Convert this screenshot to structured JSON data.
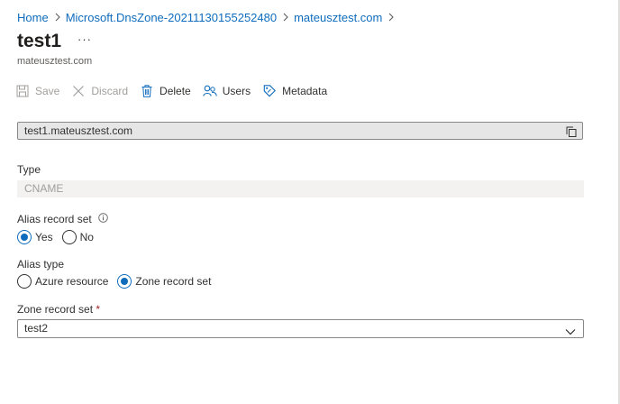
{
  "breadcrumb": {
    "items": [
      "Home",
      "Microsoft.DnsZone-20211130155252480",
      "mateusztest.com"
    ]
  },
  "header": {
    "title": "test1",
    "more_label": "···",
    "subtitle": "mateusztest.com"
  },
  "toolbar": {
    "save_label": "Save",
    "discard_label": "Discard",
    "delete_label": "Delete",
    "users_label": "Users",
    "metadata_label": "Metadata"
  },
  "form": {
    "name_value": "test1.mateusztest.com",
    "type_label": "Type",
    "type_value": "CNAME",
    "alias_record_set_label": "Alias record set",
    "alias_yes": "Yes",
    "alias_no": "No",
    "alias_selected": "Yes",
    "alias_type_label": "Alias type",
    "alias_type_azure": "Azure resource",
    "alias_type_zone": "Zone record set",
    "alias_type_selected": "Zone record set",
    "zone_record_set_label": "Zone record set",
    "required_mark": "*",
    "zone_record_set_value": "test2"
  },
  "colors": {
    "accent": "#0f6cbd",
    "required": "#a4262c",
    "disabled_text": "#a19f9d"
  },
  "icons": [
    "chevron-right-icon",
    "more-icon",
    "save-icon",
    "discard-icon",
    "delete-icon",
    "users-icon",
    "metadata-icon",
    "copy-icon",
    "info-icon",
    "chevron-down-icon"
  ]
}
